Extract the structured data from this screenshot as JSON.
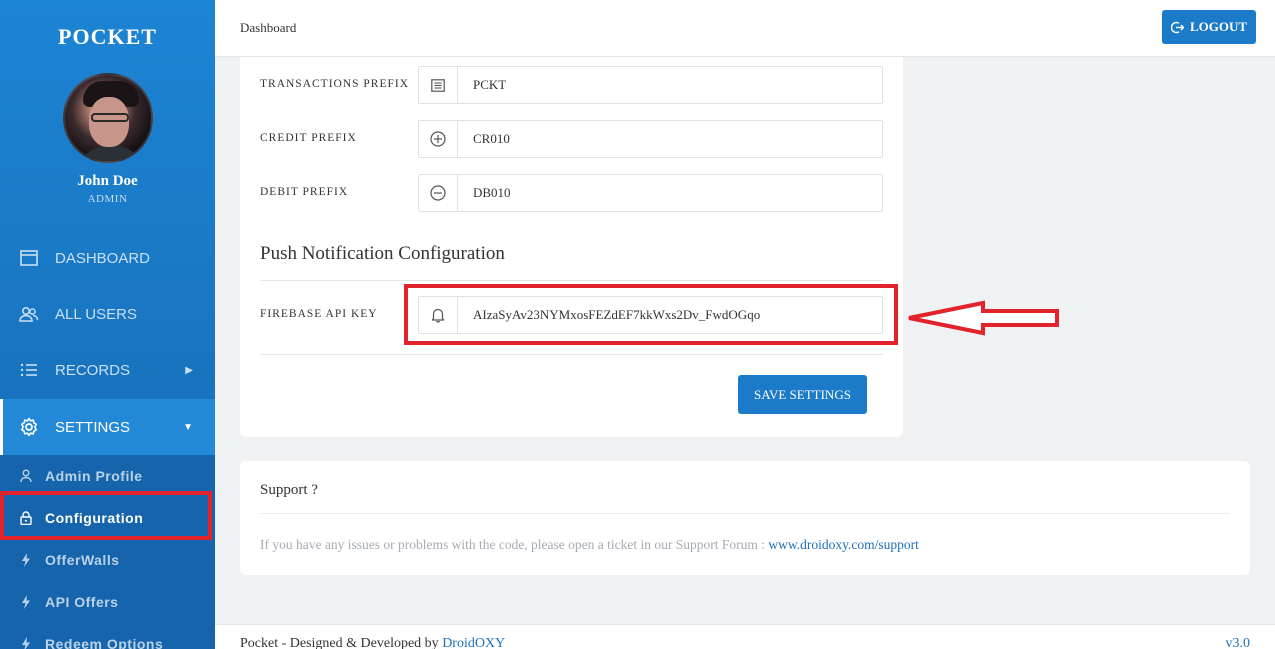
{
  "brand": "POCKET",
  "user": {
    "name": "John Doe",
    "role": "ADMIN"
  },
  "nav": {
    "items": [
      {
        "label": "DASHBOARD",
        "icon": "browser-window-icon"
      },
      {
        "label": "ALL USERS",
        "icon": "users-icon"
      },
      {
        "label": "RECORDS",
        "icon": "list-icon"
      },
      {
        "label": "SETTINGS",
        "icon": "gear-icon"
      }
    ],
    "subitems": [
      {
        "label": "Admin Profile",
        "icon": "user-icon"
      },
      {
        "label": "Configuration",
        "icon": "lock-icon"
      },
      {
        "label": "OfferWalls",
        "icon": "bolt-icon"
      },
      {
        "label": "API Offers",
        "icon": "bolt-icon"
      },
      {
        "label": "Redeem Options",
        "icon": "bolt-icon"
      }
    ]
  },
  "header": {
    "breadcrumb": "Dashboard",
    "logout_label": "LOGOUT"
  },
  "config": {
    "fields": [
      {
        "label": "TRANSACTIONS PREFIX",
        "value": "PCKT",
        "icon": "list-box-icon"
      },
      {
        "label": "CREDIT PREFIX",
        "value": "CR010",
        "icon": "plus-circle-icon"
      },
      {
        "label": "DEBIT PREFIX",
        "value": "DB010",
        "icon": "minus-circle-icon"
      }
    ],
    "push_title": "Push Notification Configuration",
    "firebase": {
      "label": "FIREBASE API KEY",
      "value": "AIzaSyAv23NYMxosFEZdEF7kkWxs2Dv_FwdOGqo",
      "icon": "bell-icon"
    },
    "save_label": "SAVE SETTINGS"
  },
  "support": {
    "title": "Support ?",
    "text": "If you have any issues or problems with the code, please open a ticket in our Support Forum : ",
    "link": "www.droidoxy.com/support"
  },
  "footer": {
    "prefix": "Pocket - Designed & Developed by ",
    "author": "DroidOXY",
    "version": "v3.0"
  },
  "annotation_color": "#e2232b",
  "accent_color": "#1c7bc8"
}
